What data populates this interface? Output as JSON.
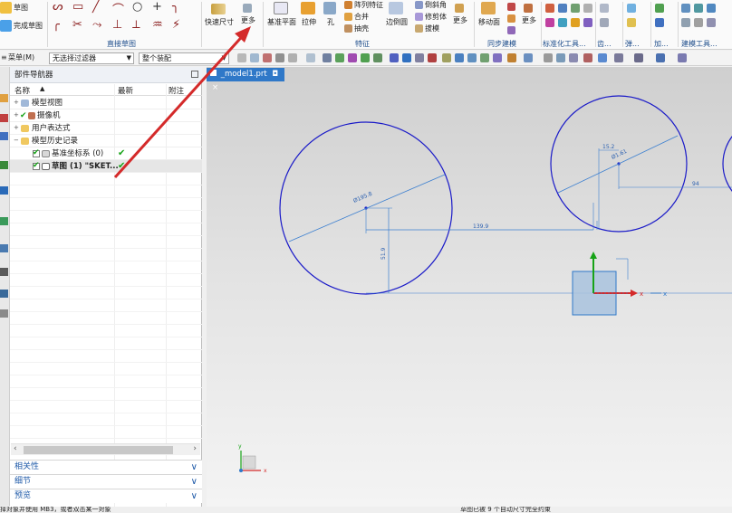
{
  "ribbon": {
    "sketch_label": "草图",
    "finish_sketch_label": "完成草图",
    "direct_sketch_group": "直接草图",
    "rapid_dimension": "快速尺寸",
    "more_1": "更多",
    "datum_plane": "基准平面",
    "extrude": "拉伸",
    "hole": "孔",
    "pattern_feature": "阵列特征",
    "combine": "合并",
    "shell": "抽壳",
    "edge_blend": "边倒圆",
    "chamfer": "倒斜角",
    "trim_body": "修剪体",
    "draft": "拔模",
    "more_2": "更多",
    "feature_group": "特征",
    "move_face": "移动面",
    "more_3": "更多",
    "sync_modeling_group": "同步建模",
    "standard_tools_group": "标准化工具...",
    "gear_group": "齿...",
    "spring_group": "弹...",
    "machining_group": "加...",
    "modeling_tools_group": "建模工具..."
  },
  "filterbar": {
    "menu_label": "菜单(M)",
    "filter_select": "无选择过滤器",
    "assembly_select": "整个装配"
  },
  "navigator": {
    "title": "部件导航器",
    "col_name": "名称",
    "col_latest": "最新",
    "col_note": "附注",
    "rows": [
      {
        "label": "模型视图"
      },
      {
        "label": "摄像机"
      },
      {
        "label": "用户表达式"
      },
      {
        "label": "模型历史记录"
      },
      {
        "label": "基准坐标系 (0)"
      },
      {
        "label": "草图 (1) \"SKET..."
      }
    ],
    "accordion": [
      "相关性",
      "细节",
      "预览"
    ]
  },
  "tab": {
    "label": "_model1.prt",
    "pin": "◘",
    "close": "×"
  },
  "dims": {
    "d1": "Ø195.8",
    "d2": "139.9",
    "d3": "51.9",
    "d4": "15.2",
    "d5": "Ø1.61",
    "d6": "94"
  },
  "axes": {
    "x": "x",
    "y": "y",
    "z": "z"
  },
  "status": {
    "left": "择对象并使用 MB3，或者双击某一对象",
    "right": "草图已被 9 个自动尺寸完全约束"
  },
  "colors": {
    "accent": "#2f78c8",
    "sketch_curve": "#1a1ac8",
    "dimension": "#3b7fd0",
    "arrow": "#d42a2a",
    "check": "#17a317"
  }
}
